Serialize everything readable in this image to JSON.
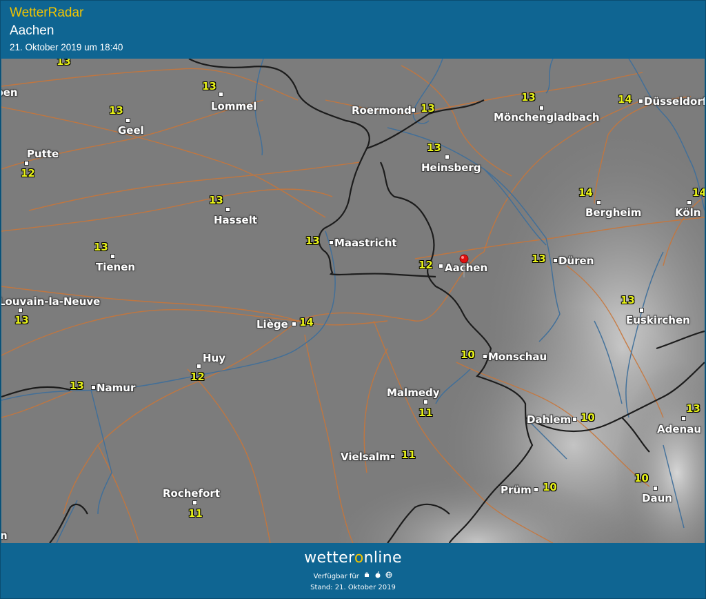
{
  "header": {
    "app_title": "WetterRadar",
    "place": "Aachen",
    "timestamp": "21. Oktober 2019 um 18:40"
  },
  "map": {
    "cities": [
      {
        "name": "Lommel",
        "temp": "13"
      },
      {
        "name": "Geel",
        "temp": "13"
      },
      {
        "name": "Putte",
        "temp": "12"
      },
      {
        "name": "Roermond",
        "temp": "13"
      },
      {
        "name": "Mönchengladbach",
        "temp": "13"
      },
      {
        "name": "Düsseldorf",
        "temp": "14"
      },
      {
        "name": "Heinsberg",
        "temp": "13"
      },
      {
        "name": "Hasselt",
        "temp": "13"
      },
      {
        "name": "Maastricht",
        "temp": "13"
      },
      {
        "name": "Bergheim",
        "temp": "14"
      },
      {
        "name": "Köln",
        "temp": "14"
      },
      {
        "name": "Tienen",
        "temp": "13"
      },
      {
        "name": "Aachen",
        "temp": "12"
      },
      {
        "name": "Düren",
        "temp": "13"
      },
      {
        "name": "Louvain-la-Neuve",
        "temp": "13"
      },
      {
        "name": "Euskirchen",
        "temp": "13"
      },
      {
        "name": "Liège",
        "temp": "14"
      },
      {
        "name": "Monschau",
        "temp": "10"
      },
      {
        "name": "Huy",
        "temp": "12"
      },
      {
        "name": "Namur",
        "temp": "13"
      },
      {
        "name": "Malmedy",
        "temp": "11"
      },
      {
        "name": "Dahlem",
        "temp": "10"
      },
      {
        "name": "Adenau",
        "temp": "13"
      },
      {
        "name": "Vielsalm",
        "temp": "11"
      },
      {
        "name": "Prüm",
        "temp": "10"
      },
      {
        "name": "Daun",
        "temp": "10"
      },
      {
        "name": "Rochefort",
        "temp": "11"
      }
    ],
    "extra_temp": "13",
    "edge_labels": [
      "pen",
      "n"
    ],
    "pin_icon": "location-pin-icon",
    "colors": {
      "roads": "#c8763a",
      "rivers": "#3f6f9a",
      "borders": "#1c1c1c",
      "temps": "#e8f21a"
    }
  },
  "footer": {
    "brand_pre": "wetter",
    "brand_o": "o",
    "brand_post": "nline",
    "available": "Verfügbar für",
    "stand": "Stand: 21. Oktober 2019",
    "icons": [
      "android-icon",
      "apple-icon",
      "web-icon"
    ]
  }
}
